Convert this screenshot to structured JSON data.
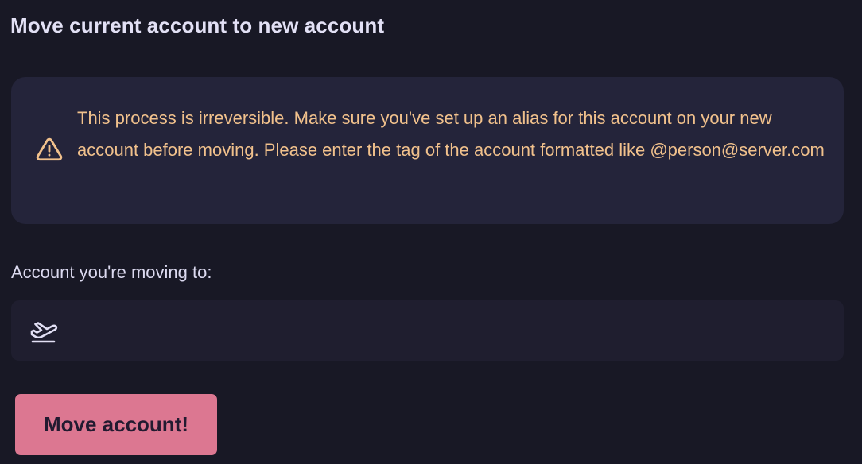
{
  "page": {
    "title": "Move current account to new account"
  },
  "warning": {
    "icon": "warning-triangle-icon",
    "text": "This process is irreversible. Make sure you've set up an alias for this account on your new account before moving. Please enter the tag of the account formatted like @person@server.com",
    "color": "#f1c18c"
  },
  "form": {
    "label": "Account you're moving to:",
    "input_icon": "airplane-takeoff-icon",
    "input_value": "",
    "input_placeholder": ""
  },
  "actions": {
    "submit_label": "Move account!",
    "submit_color": "#dc7791"
  }
}
